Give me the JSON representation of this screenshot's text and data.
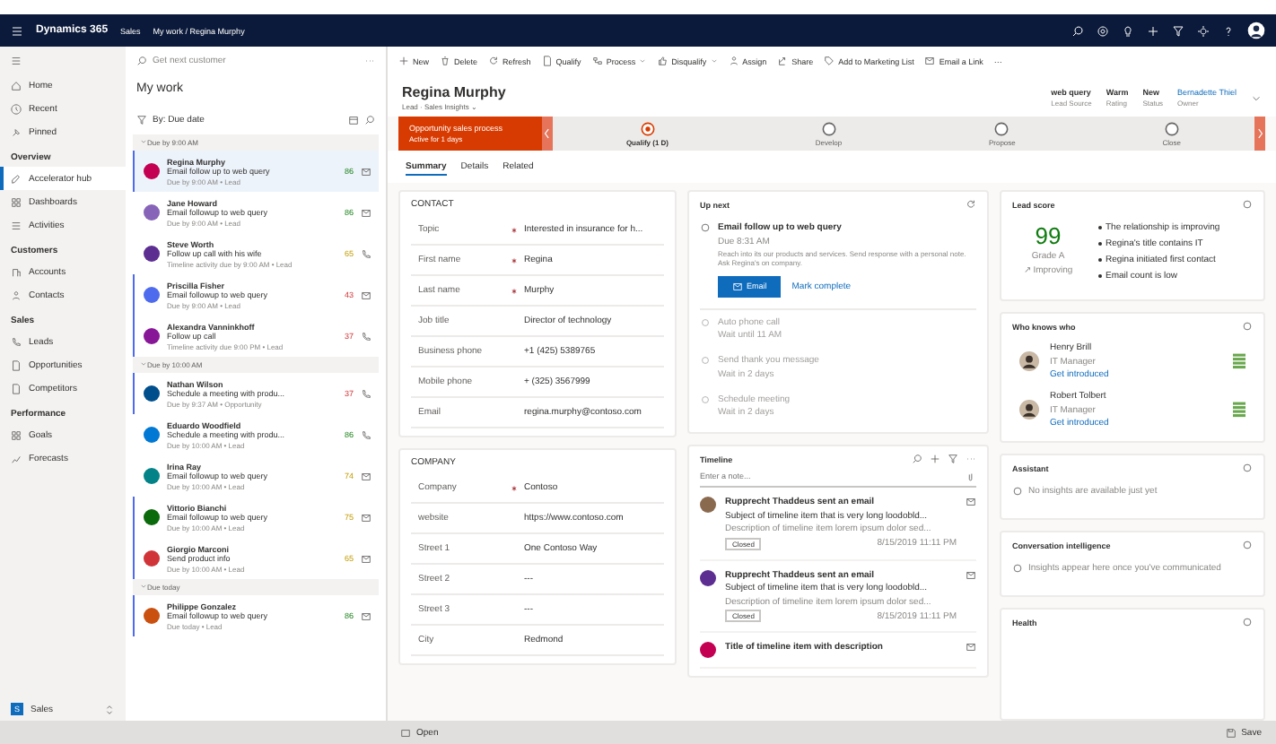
{
  "topbar": {
    "app": "Dynamics 365",
    "area": "Sales",
    "breadcrumb": "My work / Regina Murphy"
  },
  "nav": {
    "top": [
      {
        "label": "Home"
      },
      {
        "label": "Recent"
      },
      {
        "label": "Pinned"
      }
    ],
    "sections": [
      {
        "title": "Overview",
        "items": [
          {
            "label": "Accelerator hub",
            "selected": true
          },
          {
            "label": "Dashboards",
            "selected": false
          },
          {
            "label": "Activities",
            "selected": false
          }
        ]
      },
      {
        "title": "Customers",
        "items": [
          {
            "label": "Accounts",
            "selected": false
          },
          {
            "label": "Contacts",
            "selected": false
          }
        ]
      },
      {
        "title": "Sales",
        "items": [
          {
            "label": "Leads",
            "selected": false
          },
          {
            "label": "Opportunities",
            "selected": false
          },
          {
            "label": "Competitors",
            "selected": false
          }
        ]
      },
      {
        "title": "Performance",
        "items": [
          {
            "label": "Goals",
            "selected": false
          },
          {
            "label": "Forecasts",
            "selected": false
          }
        ]
      }
    ],
    "area_badge": "S",
    "area_label": "Sales"
  },
  "worklist": {
    "search": "Get next customer",
    "title": "My work",
    "filter": "By: Due date",
    "groups": [
      {
        "label": "Due by 9:00 AM",
        "items": [
          {
            "name": "Regina Murphy",
            "task": "Email follow up to web query",
            "meta": "Due by 9:00 AM • Lead",
            "score": "86",
            "kind": "email",
            "color": "#c30052",
            "accent": true,
            "selected": true
          },
          {
            "name": "Jane Howard",
            "task": "Email followup to web query",
            "meta": "Due by 9:00 AM • Lead",
            "score": "86",
            "kind": "email",
            "color": "#8764b8",
            "accent": false,
            "selected": false
          },
          {
            "name": "Steve Worth",
            "task": "Follow up call with his wife",
            "meta": "Timeline activity due by 9:00 AM • Lead",
            "score": "65",
            "kind": "phone",
            "color": "#5c2e91",
            "accent": false,
            "selected": false
          },
          {
            "name": "Priscilla Fisher",
            "task": "Email followup to web query",
            "meta": "Due by 9:00 AM • Lead",
            "score": "43",
            "kind": "email",
            "color": "#4f6bed",
            "accent": true,
            "selected": false
          },
          {
            "name": "Alexandra Vanninkhoff",
            "task": "Follow up call",
            "meta": "Timeline activity due 9:00 PM • Lead",
            "score": "37",
            "kind": "phone",
            "color": "#881798",
            "accent": true,
            "selected": false
          }
        ]
      },
      {
        "label": "Due by 10:00 AM",
        "items": [
          {
            "name": "Nathan Wilson",
            "task": "Schedule a meeting with produ...",
            "meta": "Due by 9:37 AM • Opportunity",
            "score": "37",
            "kind": "phone",
            "color": "#004e8c",
            "accent": true,
            "selected": false
          },
          {
            "name": "Eduardo Woodfield",
            "task": "Schedule a meeting with produ...",
            "meta": "Due by 10:00 AM • Lead",
            "score": "86",
            "kind": "phone",
            "color": "#0078d4",
            "accent": false,
            "selected": false
          },
          {
            "name": "Irina Ray",
            "task": "Email followup to web query",
            "meta": "Due by 10:00 AM • Lead",
            "score": "74",
            "kind": "email",
            "color": "#038387",
            "accent": false,
            "selected": false
          },
          {
            "name": "Vittorio Bianchi",
            "task": "Email followup to web query",
            "meta": "Due by 10:00 AM • Lead",
            "score": "75",
            "kind": "email",
            "color": "#0b6a0b",
            "accent": true,
            "selected": false
          },
          {
            "name": "Giorgio Marconi",
            "task": "Send product info",
            "meta": "Due by 10:00 AM • Lead",
            "score": "65",
            "kind": "email",
            "color": "#d13438",
            "accent": true,
            "selected": false
          }
        ]
      },
      {
        "label": "Due today",
        "items": [
          {
            "name": "Philippe Gonzalez",
            "task": "Email followup to web query",
            "meta": "Due today • Lead",
            "score": "86",
            "kind": "email",
            "color": "#ca5010",
            "accent": true,
            "selected": false
          }
        ]
      }
    ]
  },
  "commands": [
    {
      "label": "New",
      "caret": false
    },
    {
      "label": "Delete",
      "caret": false
    },
    {
      "label": "Refresh",
      "caret": false
    },
    {
      "label": "Qualify",
      "caret": false
    },
    {
      "label": "Process",
      "caret": true
    },
    {
      "label": "Disqualify",
      "caret": true
    },
    {
      "label": "Assign",
      "caret": false
    },
    {
      "label": "Share",
      "caret": false
    },
    {
      "label": "Add to Marketing List",
      "caret": false
    },
    {
      "label": "Email a Link",
      "caret": false
    },
    {
      "label": "···",
      "caret": false
    }
  ],
  "record": {
    "title": "Regina Murphy",
    "subtitle": "Lead · Sales Insights ⌄",
    "header_fields": [
      {
        "value": "web query",
        "label": "Lead Source",
        "link": false
      },
      {
        "value": "Warm",
        "label": "Rating",
        "link": false
      },
      {
        "value": "New",
        "label": "Status",
        "link": false
      },
      {
        "value": "Bernadette Thiel",
        "label": "Owner",
        "link": true
      }
    ]
  },
  "process": {
    "title": "Opportunity sales process",
    "subtitle": "Active for 1 days",
    "stages": [
      {
        "label": "Qualify (1 D)",
        "selected": true
      },
      {
        "label": "Develop",
        "selected": false
      },
      {
        "label": "Propose",
        "selected": false
      },
      {
        "label": "Close",
        "selected": false
      }
    ]
  },
  "tabs": [
    {
      "label": "Summary",
      "selected": true
    },
    {
      "label": "Details",
      "selected": false
    },
    {
      "label": "Related",
      "selected": false
    }
  ],
  "contact": {
    "title": "CONTACT",
    "fields": [
      {
        "label": "Topic",
        "required": true,
        "value": "Interested in insurance for h..."
      },
      {
        "label": "First name",
        "required": true,
        "value": "Regina"
      },
      {
        "label": "Last name",
        "required": true,
        "value": "Murphy"
      },
      {
        "label": "Job title",
        "required": false,
        "value": "Director of technology"
      },
      {
        "label": "Business phone",
        "required": false,
        "value": "+1 (425) 5389765"
      },
      {
        "label": "Mobile phone",
        "required": false,
        "value": "+ (325) 3567999"
      },
      {
        "label": "Email",
        "required": false,
        "value": "regina.murphy@contoso.com"
      }
    ]
  },
  "company": {
    "title": "COMPANY",
    "fields": [
      {
        "label": "Company",
        "required": true,
        "value": "Contoso"
      },
      {
        "label": "website",
        "required": false,
        "value": "https://www.contoso.com"
      },
      {
        "label": "Street 1",
        "required": false,
        "value": "One Contoso Way"
      },
      {
        "label": "Street 2",
        "required": false,
        "value": "---"
      },
      {
        "label": "Street 3",
        "required": false,
        "value": "---"
      },
      {
        "label": "City",
        "required": false,
        "value": "Redmond"
      }
    ]
  },
  "up_next": {
    "title": "Up next",
    "current": {
      "title": "Email follow up to web query",
      "due": "Due 8:31 AM",
      "description": "Reach into its our products and services. Send response with a personal note. Ask Regina's on company.",
      "primary": "Email",
      "secondary": "Mark complete"
    },
    "steps": [
      {
        "title": "Auto phone call",
        "wait": "Wait until 11 AM"
      },
      {
        "title": "Send thank you message",
        "wait": "Wait in 2 days"
      },
      {
        "title": "Schedule meeting",
        "wait": "Wait in 2 days"
      }
    ]
  },
  "timeline": {
    "title": "Timeline",
    "placeholder": "Enter a note...",
    "items": [
      {
        "title": "Rupprecht Thaddeus sent an email",
        "subject": "Subject of timeline item that is very long loodobld...",
        "description": "Description of timeline item lorem ipsum dolor sed...",
        "tag": "Closed",
        "date": "8/15/2019 11:11 PM",
        "color": "#8a6a4f"
      },
      {
        "title": "Rupprecht Thaddeus sent an email",
        "subject": "Subject of timeline item that is very long loodobld...",
        "description": "Description of timeline item lorem ipsum dolor sed...",
        "tag": "Closed",
        "date": "8/15/2019 11:11 PM",
        "color": "#5c2e91"
      },
      {
        "title": "Title of timeline item with description",
        "color": "#c30052"
      }
    ]
  },
  "lead_score": {
    "title": "Lead score",
    "score": "99",
    "grade": "Grade A",
    "trend": "↗ Improving",
    "reasons": [
      "The relationship is improving",
      "Regina's title contains IT",
      "Regina initiated first contact",
      "Email count is low"
    ]
  },
  "who_knows": {
    "title": "Who knows who",
    "people": [
      {
        "name": "Henry Brill",
        "role": "IT Manager",
        "action": "Get introduced"
      },
      {
        "name": "Robert Tolbert",
        "role": "IT Manager",
        "action": "Get introduced"
      }
    ]
  },
  "assistant": {
    "title": "Assistant",
    "message": "No insights are available just yet"
  },
  "conversation": {
    "title": "Conversation intelligence",
    "message": "Insights appear here once you've communicated"
  },
  "health": {
    "title": "Health"
  },
  "status_bar": {
    "left": "Open",
    "right": "Save"
  }
}
